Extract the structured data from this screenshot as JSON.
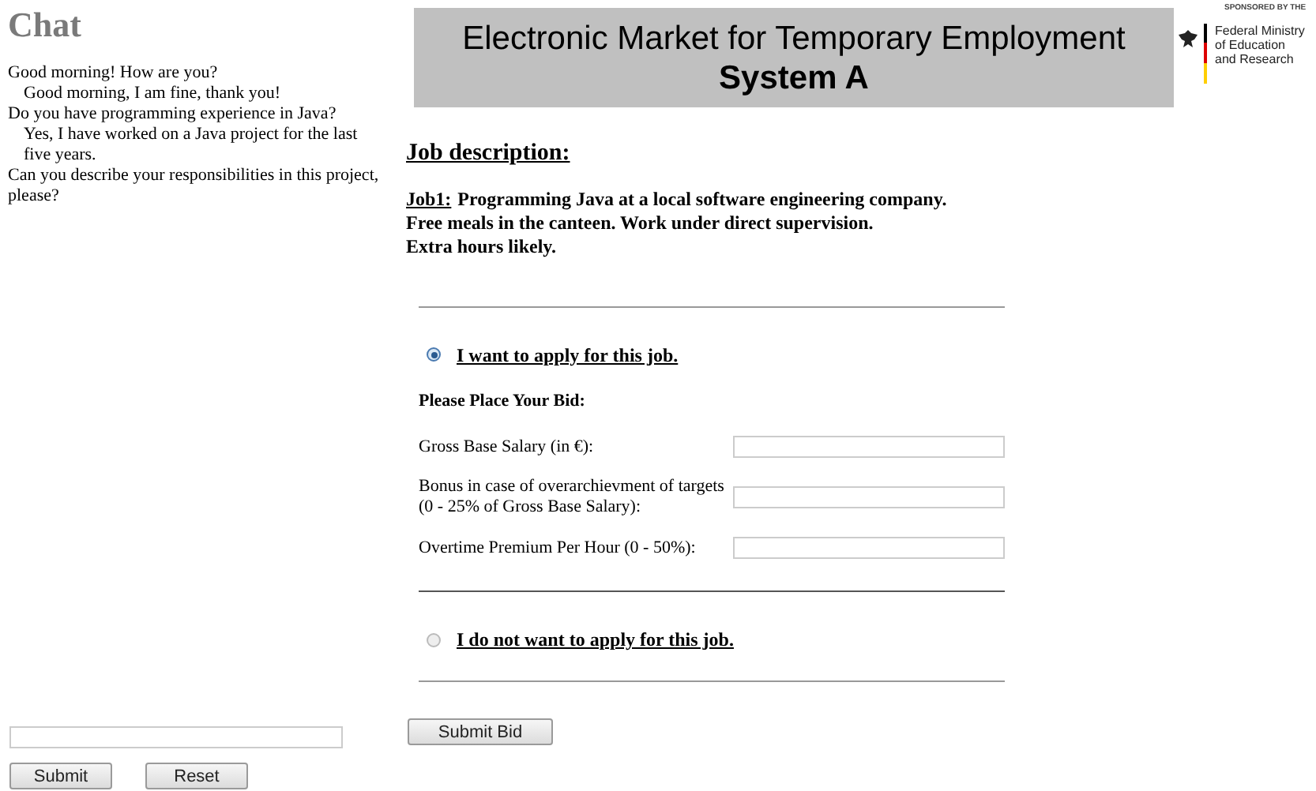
{
  "chat": {
    "title": "Chat",
    "messages": [
      {
        "kind": "question",
        "text": "Good morning! How are you?"
      },
      {
        "kind": "answer",
        "text": "Good morning, I am fine, thank you!"
      },
      {
        "kind": "question",
        "text": "Do you have programming experience in Java?"
      },
      {
        "kind": "answer",
        "text": "Yes, I have worked on a Java project for the last five years."
      },
      {
        "kind": "question",
        "text": "Can you describe your responsibilities in this project, please?"
      }
    ],
    "buttons": [
      "Submit",
      "Reset"
    ]
  },
  "header": {
    "title": "Electronic Market for Temporary Employment",
    "subtitle": "System A"
  },
  "sponsor": {
    "caption": "SPONSORED BY THE",
    "name_lines": [
      "Federal Ministry",
      "of Education",
      "and Research"
    ]
  },
  "job": {
    "heading": "Job description:",
    "label": "Job1:",
    "lines": [
      "Programming Java at a local software engineering company.",
      "Free meals in the canteen. Work under direct supervision.",
      "Extra hours likely."
    ]
  },
  "options": [
    {
      "label": "I want to apply for this job.",
      "selected": true
    },
    {
      "label": "I do not want to apply for this job.",
      "selected": false
    }
  ],
  "bid": {
    "heading": "Please Place Your Bid:",
    "fields": [
      {
        "label_lines": [
          "Gross Base Salary (in €):"
        ]
      },
      {
        "label_lines": [
          "Bonus in case of overarchievment of targets",
          "(0 - 25% of Gross Base Salary):"
        ]
      },
      {
        "label_lines": [
          "Overtime Premium Per Hour (0 - 50%):"
        ]
      }
    ]
  },
  "submit_bid": "Submit Bid"
}
